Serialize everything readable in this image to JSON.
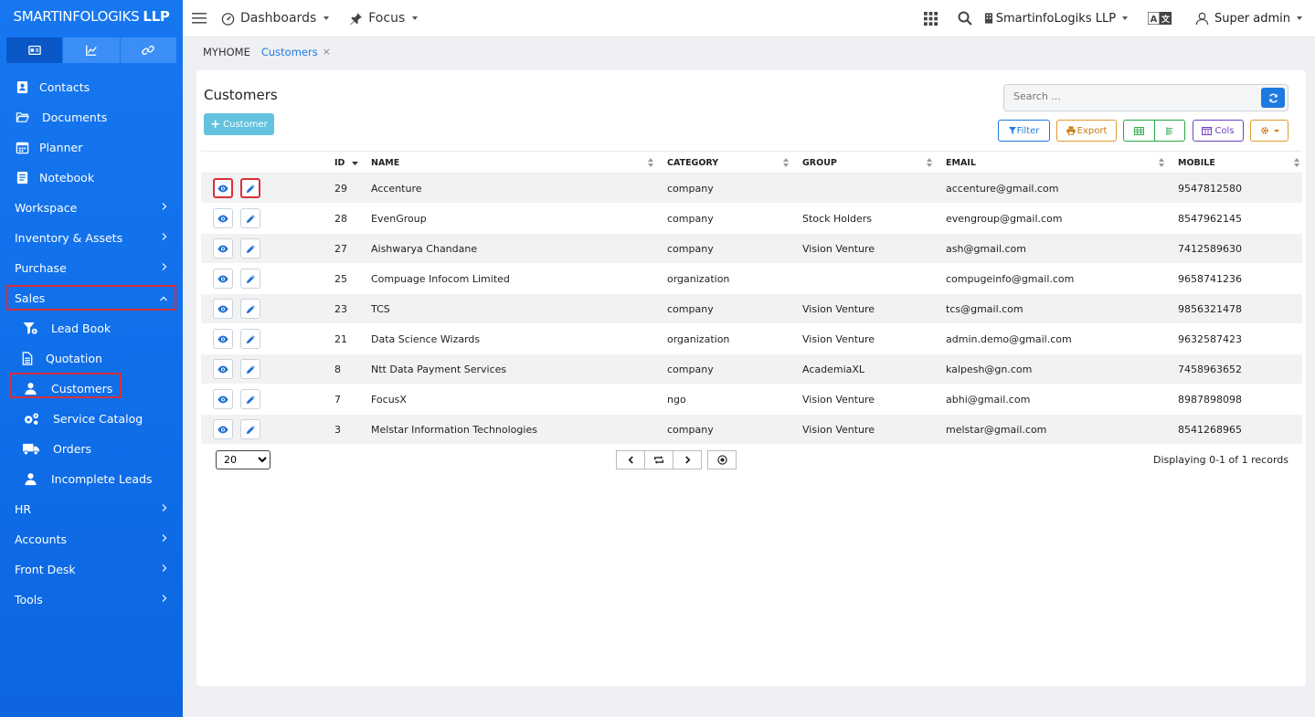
{
  "brand": {
    "name": "SMARTINFOLOGIKS",
    "suffix": "LLP"
  },
  "sidebar": {
    "tabs": [
      {
        "icon": "id-card-icon"
      },
      {
        "icon": "chart-line-icon"
      },
      {
        "icon": "link-icon"
      }
    ],
    "items": [
      {
        "label": "Contacts",
        "icon": "contact-book-icon"
      },
      {
        "label": "Documents",
        "icon": "folder-open-icon"
      },
      {
        "label": "Planner",
        "icon": "calendar-icon"
      },
      {
        "label": "Notebook",
        "icon": "notebook-icon"
      },
      {
        "label": "Workspace",
        "expandable": true
      },
      {
        "label": "Inventory & Assets",
        "expandable": true
      },
      {
        "label": "Purchase",
        "expandable": true
      },
      {
        "label": "Sales",
        "expandable": true,
        "expanded": true
      },
      {
        "label": "Lead Book",
        "icon": "funnel-icon",
        "sub": true
      },
      {
        "label": "Quotation",
        "icon": "file-icon",
        "sub": true
      },
      {
        "label": "Customers",
        "icon": "user-icon",
        "sub": true,
        "active": true
      },
      {
        "label": "Service Catalog",
        "icon": "gears-icon",
        "sub": true
      },
      {
        "label": "Orders",
        "icon": "truck-icon",
        "sub": true
      },
      {
        "label": "Incomplete Leads",
        "icon": "user-icon",
        "sub": true
      },
      {
        "label": "HR",
        "expandable": true
      },
      {
        "label": "Accounts",
        "expandable": true
      },
      {
        "label": "Front Desk",
        "expandable": true
      },
      {
        "label": "Tools",
        "expandable": true
      }
    ]
  },
  "topbar": {
    "dashboards_label": "Dashboards",
    "focus_label": "Focus",
    "org_label": "SmartinfoLogiks LLP",
    "user_label": "Super admin"
  },
  "breadcrumb": {
    "home": "MYHOME",
    "current": "Customers",
    "close": "×"
  },
  "page": {
    "title": "Customers",
    "add_label": "Customer",
    "search_placeholder": "Search ...",
    "filter_label": "Filter",
    "export_label": "Export",
    "cols_label": "Cols"
  },
  "table": {
    "columns": [
      "ID",
      "NAME",
      "CATEGORY",
      "GROUP",
      "EMAIL",
      "MOBILE"
    ],
    "rows": [
      {
        "id": "29",
        "name": "Accenture",
        "category": "company",
        "group": "",
        "email": "accenture@gmail.com",
        "mobile": "9547812580"
      },
      {
        "id": "28",
        "name": "EvenGroup",
        "category": "company",
        "group": "Stock Holders",
        "email": "evengroup@gmail.com",
        "mobile": "8547962145"
      },
      {
        "id": "27",
        "name": "Aishwarya Chandane",
        "category": "company",
        "group": "Vision Venture",
        "email": "ash@gmail.com",
        "mobile": "7412589630"
      },
      {
        "id": "25",
        "name": "Compuage Infocom Limited",
        "category": "organization",
        "group": "",
        "email": "compugeinfo@gmail.com",
        "mobile": "9658741236"
      },
      {
        "id": "23",
        "name": "TCS",
        "category": "company",
        "group": "Vision Venture",
        "email": "tcs@gmail.com",
        "mobile": "9856321478"
      },
      {
        "id": "21",
        "name": "Data Science Wizards",
        "category": "organization",
        "group": "Vision Venture",
        "email": "admin.demo@gmail.com",
        "mobile": "9632587423"
      },
      {
        "id": "8",
        "name": "Ntt Data Payment Services",
        "category": "company",
        "group": "AcademiaXL",
        "email": "kalpesh@gn.com",
        "mobile": "7458963652"
      },
      {
        "id": "7",
        "name": "FocusX",
        "category": "ngo",
        "group": "Vision Venture",
        "email": "abhi@gmail.com",
        "mobile": "8987898098"
      },
      {
        "id": "3",
        "name": "Melstar Information Technologies",
        "category": "company",
        "group": "Vision Venture",
        "email": "melstar@gmail.com",
        "mobile": "8541268965"
      }
    ]
  },
  "pager": {
    "page_size": "20",
    "page_size_options": [
      "20"
    ],
    "display_text": "Displaying 0-1 of 1 records"
  },
  "colors": {
    "sidebar": "#1677f0",
    "primary": "#1f7ae0",
    "highlight": "#d9303a",
    "add_button": "#5bc0de"
  }
}
